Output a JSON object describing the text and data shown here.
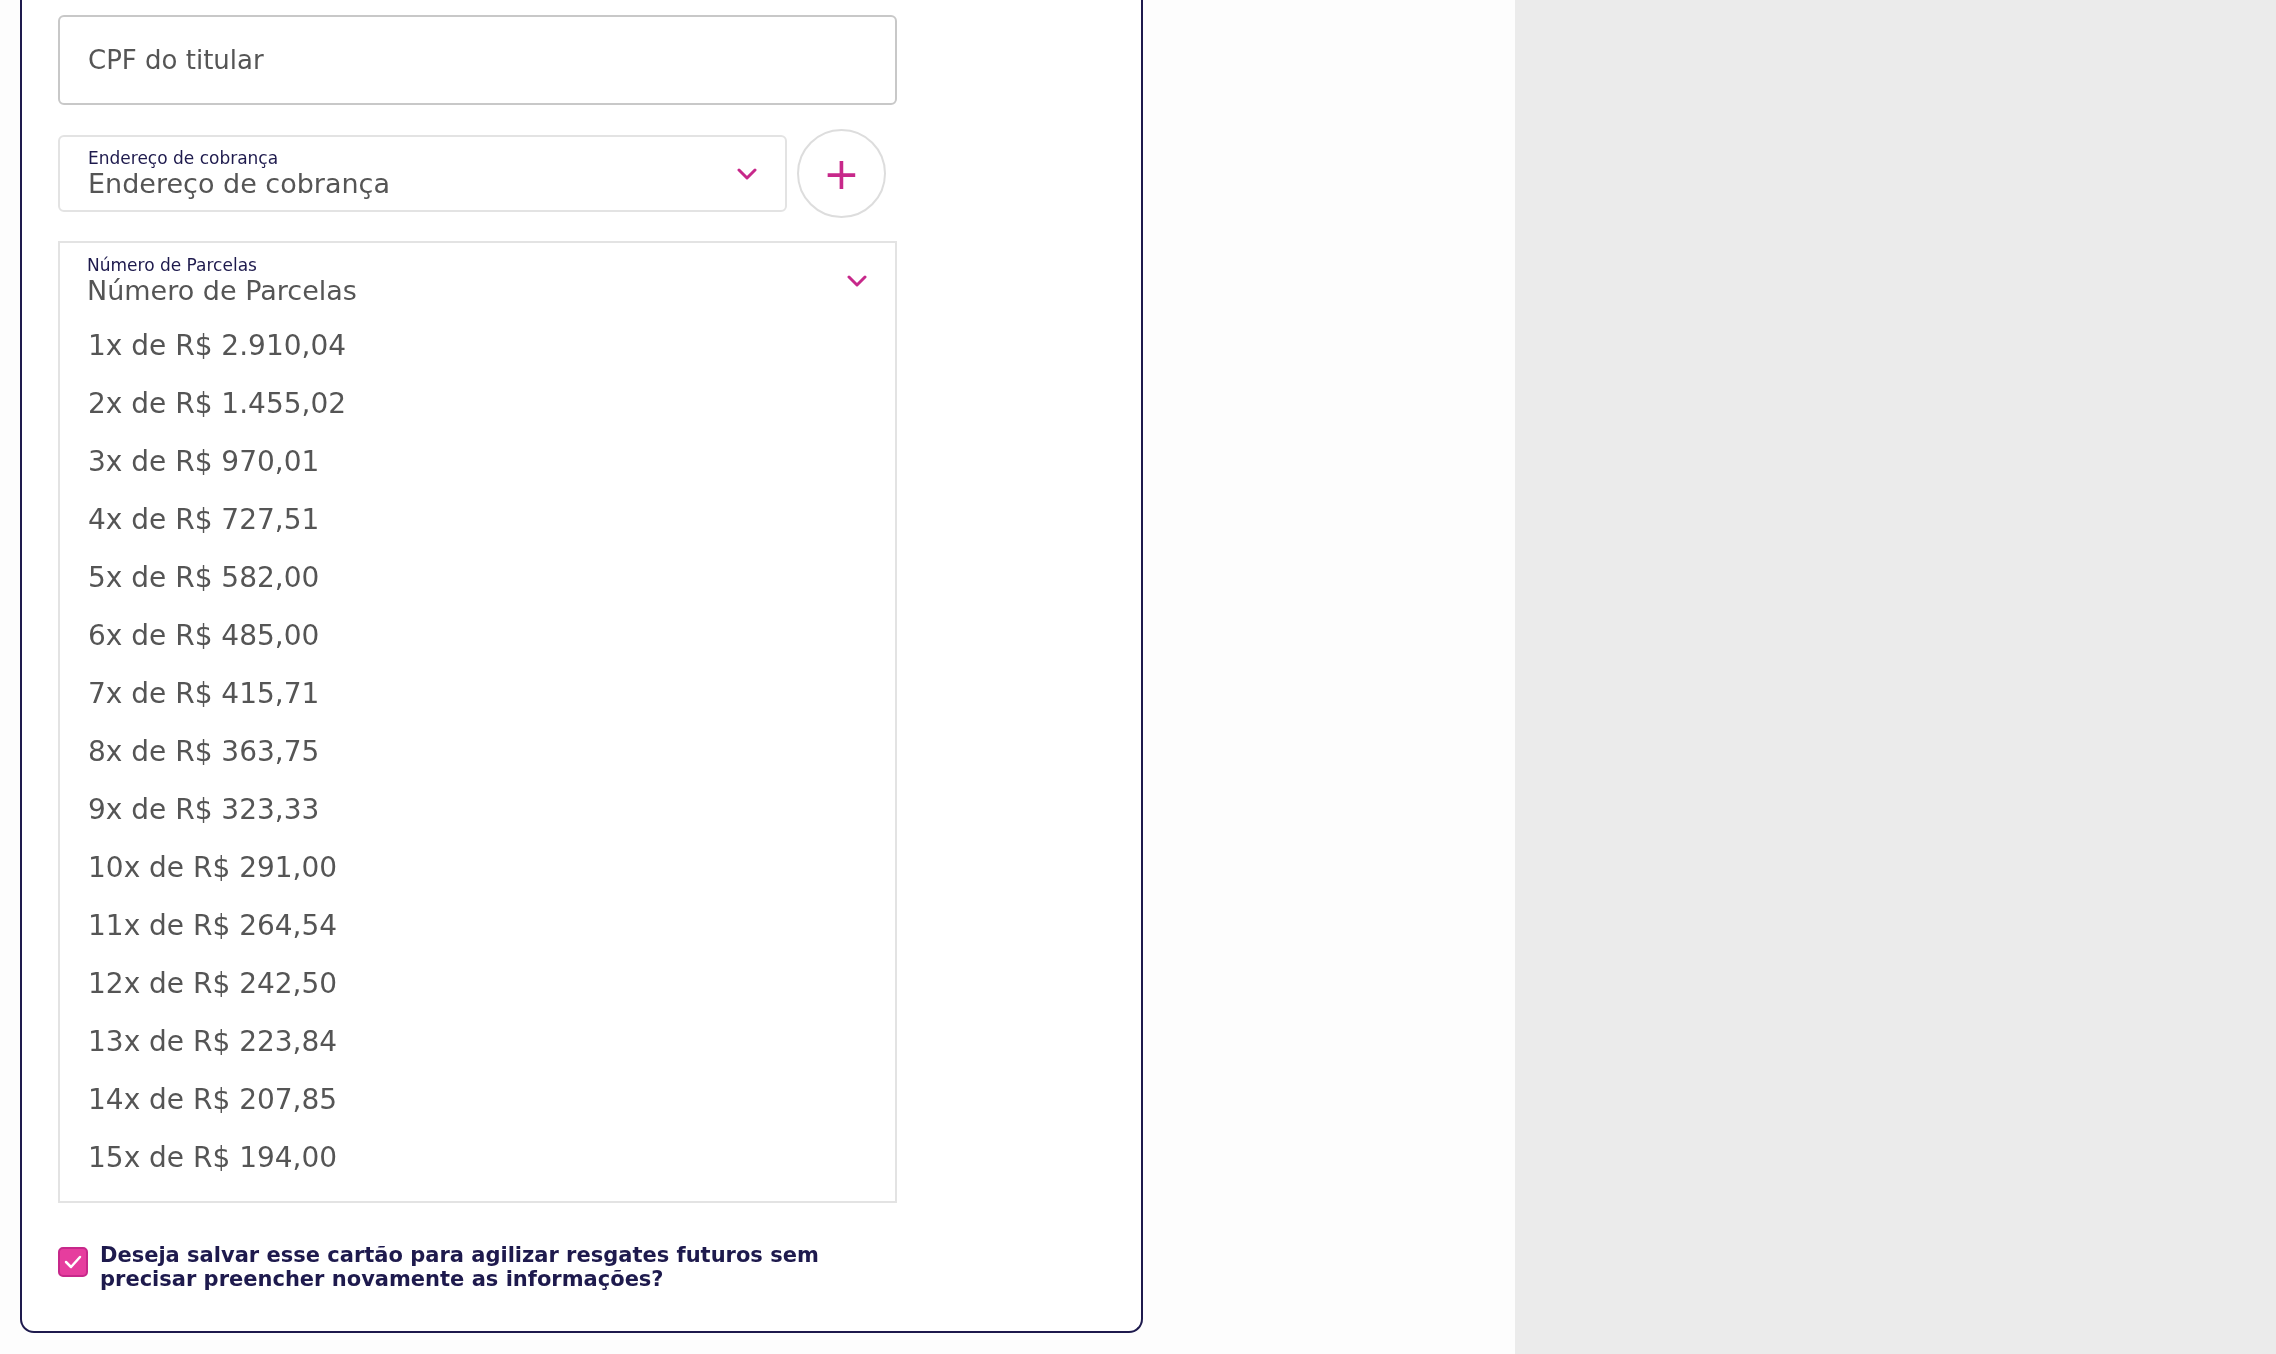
{
  "cpf_field": {
    "placeholder": "CPF do titular"
  },
  "billing_address": {
    "label": "Endereço de cobrança",
    "value": "Endereço de cobrança"
  },
  "add_address_button": {
    "label": "+"
  },
  "installments": {
    "label": "Número de Parcelas",
    "value": "Número de Parcelas",
    "expanded": true,
    "options": [
      {
        "text": "1x de R$ 2.910,04"
      },
      {
        "text": "2x de R$ 1.455,02"
      },
      {
        "text": "3x de R$ 970,01"
      },
      {
        "text": "4x de R$ 727,51"
      },
      {
        "text": "5x de R$ 582,00"
      },
      {
        "text": "6x de R$ 485,00"
      },
      {
        "text": "7x de R$ 415,71"
      },
      {
        "text": "8x de R$ 363,75"
      },
      {
        "text": "9x de R$ 323,33"
      },
      {
        "text": "10x de R$ 291,00"
      },
      {
        "text": "11x de R$ 264,54"
      },
      {
        "text": "12x de R$ 242,50"
      },
      {
        "text": "13x de R$ 223,84"
      },
      {
        "text": "14x de R$ 207,85"
      },
      {
        "text": "15x de R$ 194,00"
      }
    ]
  },
  "save_card": {
    "label": "Deseja salvar esse cartão para agilizar resgates futuros sem precisar preencher novamente as informações?",
    "checked": true
  }
}
